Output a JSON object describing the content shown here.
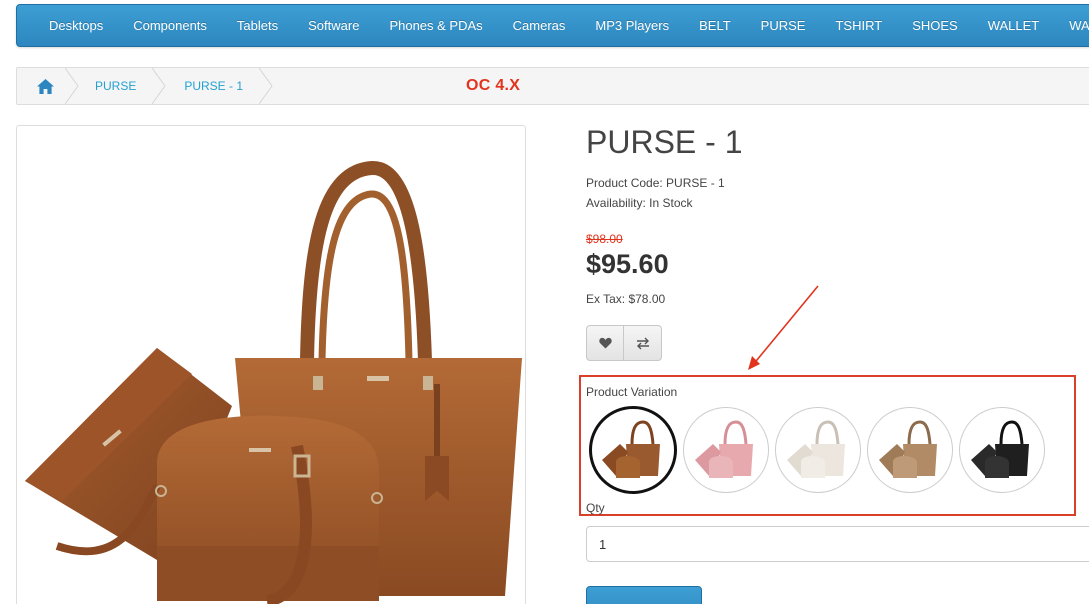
{
  "menu": {
    "items": [
      "Desktops",
      "Components",
      "Tablets",
      "Software",
      "Phones & PDAs",
      "Cameras",
      "MP3 Players",
      "BELT",
      "PURSE",
      "TSHIRT",
      "SHOES",
      "WALLET",
      "WATCH"
    ]
  },
  "breadcrumb": {
    "home_icon": "home-icon",
    "items": [
      "PURSE",
      "PURSE - 1"
    ]
  },
  "annotation": {
    "tag": "OC 4.X"
  },
  "product": {
    "title": "PURSE - 1",
    "code": "Product Code: PURSE - 1",
    "availability": "Availability: In Stock",
    "old_price": "$98.00",
    "price": "$95.60",
    "ex_tax": "Ex Tax: $78.00"
  },
  "variation": {
    "label": "Product Variation",
    "swatches": [
      {
        "color": "#9a5a2f",
        "selected": true
      },
      {
        "color": "#e7a9ae",
        "selected": false
      },
      {
        "color": "#ece6df",
        "selected": false
      },
      {
        "color": "#b18a66",
        "selected": false
      },
      {
        "color": "#1f1f1f",
        "selected": false
      }
    ]
  },
  "qty": {
    "label": "Qty",
    "value": "1"
  },
  "colors": {
    "accent": "#2d86bf",
    "link": "#23a1d1",
    "highlight": "#d9402a",
    "purse": "#a35f2e"
  }
}
